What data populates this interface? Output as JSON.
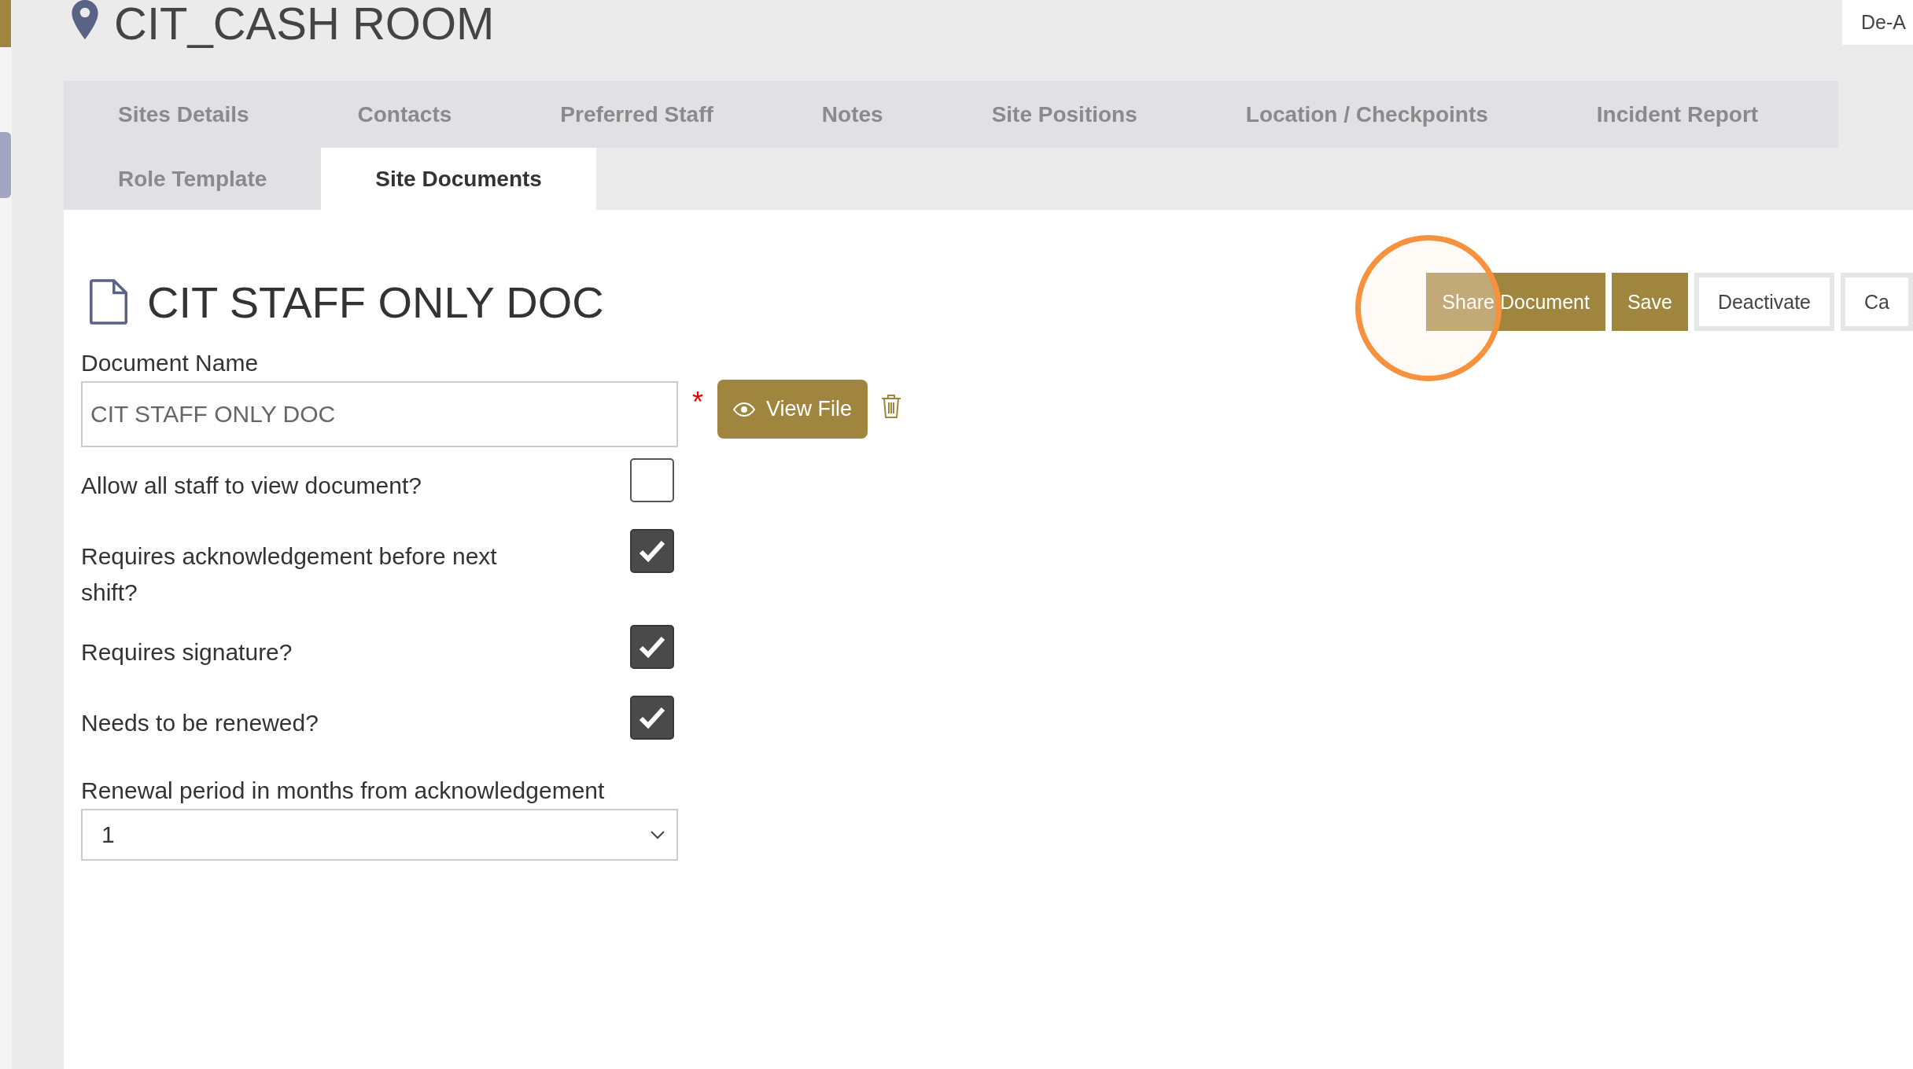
{
  "page_title": "CIT_CASH ROOM",
  "corner_button": "De-A",
  "tab_rows": [
    [
      {
        "label": "Sites Details",
        "selected": false
      },
      {
        "label": "Contacts",
        "selected": false
      },
      {
        "label": "Preferred Staff",
        "selected": false
      },
      {
        "label": "Notes",
        "selected": false
      },
      {
        "label": "Site Positions",
        "selected": false
      },
      {
        "label": "Location / Checkpoints",
        "selected": false
      },
      {
        "label": "Incident Report",
        "selected": false
      }
    ],
    [
      {
        "label": "Role Template",
        "selected": false
      },
      {
        "label": "Site Documents",
        "selected": true
      }
    ]
  ],
  "document_title": "CIT STAFF ONLY DOC",
  "actions": [
    {
      "label": "Share Document",
      "kind": "primary"
    },
    {
      "label": "Save",
      "kind": "primary"
    },
    {
      "label": "Deactivate",
      "kind": "outline"
    },
    {
      "label": "Ca",
      "kind": "outline"
    }
  ],
  "document_name": {
    "label": "Document Name",
    "value": "CIT STAFF ONLY DOC",
    "required_mark": "*",
    "view_button": "View File"
  },
  "options": [
    {
      "label": "Allow all staff to view document?",
      "checked": false
    },
    {
      "label": "Requires acknowledgement before next shift?",
      "checked": true
    },
    {
      "label": "Requires signature?",
      "checked": true
    },
    {
      "label": "Needs to be renewed?",
      "checked": true
    }
  ],
  "renewal": {
    "label": "Renewal period in months from acknowledgement",
    "value": "1"
  }
}
